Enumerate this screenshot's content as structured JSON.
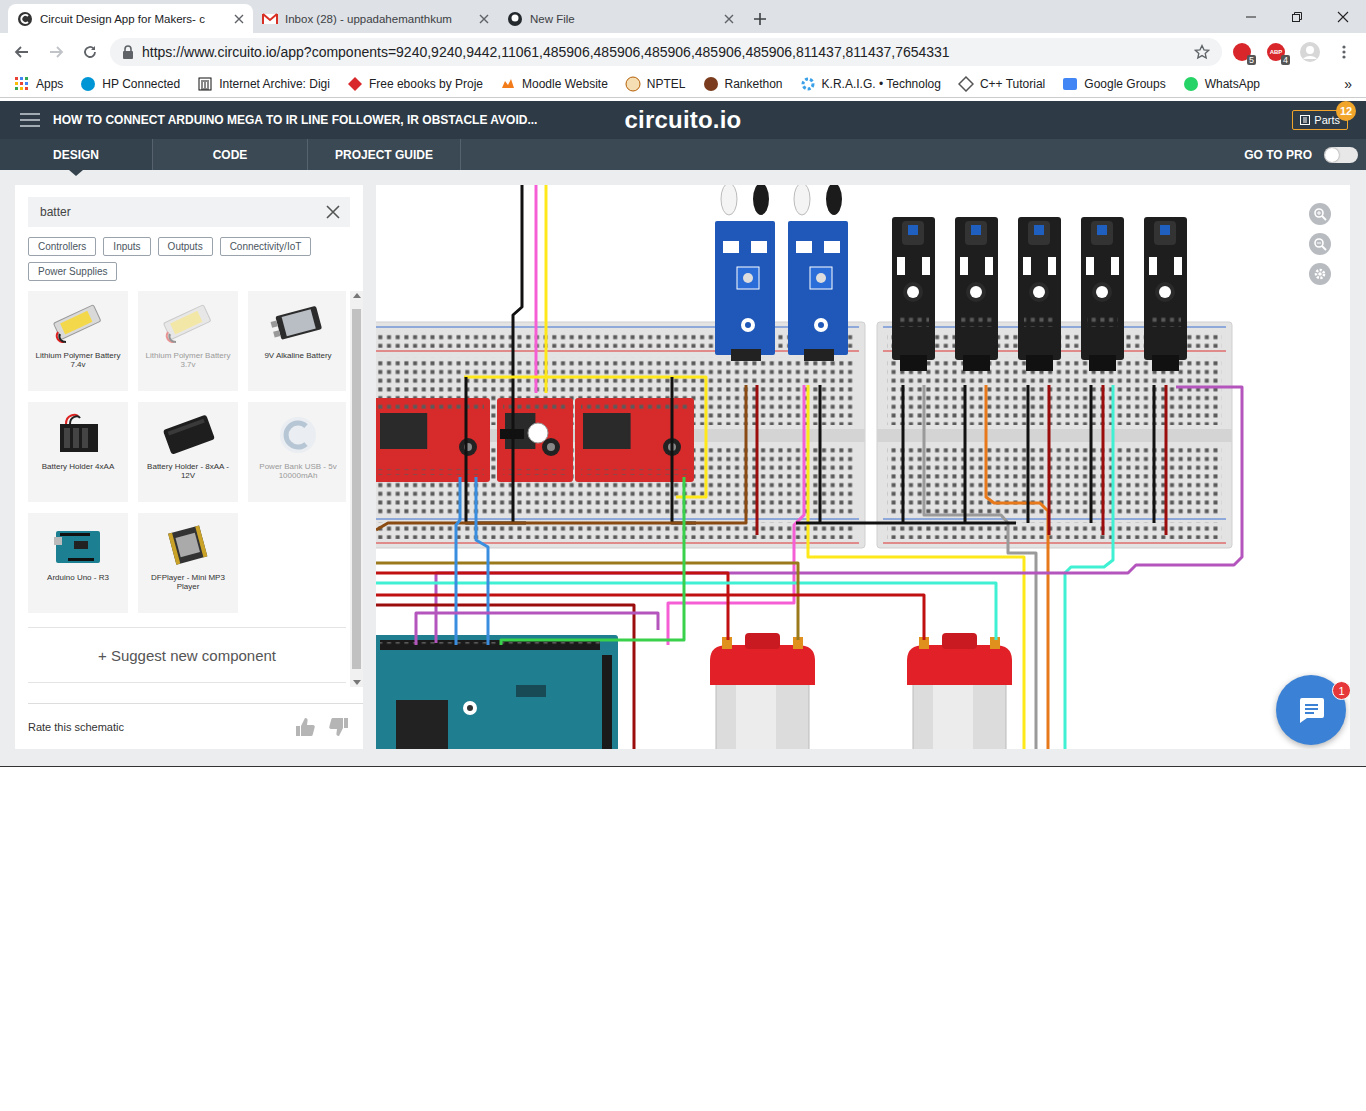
{
  "browser": {
    "tabs": [
      {
        "label": "Circuit Design App for Makers- c",
        "selected": true
      },
      {
        "label": "Inbox (28) - uppadahemanthkum",
        "selected": false
      },
      {
        "label": "New File",
        "selected": false
      }
    ],
    "url": "https://www.circuito.io/app?components=9240,9240,9442,11061,485906,485906,485906,485906,485906,811437,811437,7654331",
    "extensions": [
      {
        "label": "",
        "badge": "5"
      },
      {
        "label": "ABP",
        "badge": "4"
      }
    ],
    "bookmarks": [
      "Apps",
      "HP Connected",
      "Internet Archive: Digi",
      "Free ebooks by Proje",
      "Moodle Website",
      "NPTEL",
      "Rankethon",
      "K.R.A.I.G. • Technolog",
      "C++ Tutorial",
      "Google Groups",
      "WhatsApp"
    ],
    "more": "»"
  },
  "app": {
    "title": "HOW TO CONNECT ARDUINO MEGA TO IR LINE FOLLOWER, IR OBSTACLE AVOID...",
    "logo": "circuito.io",
    "parts": {
      "label": "Parts",
      "count": "12"
    }
  },
  "nav": {
    "tabs": [
      {
        "label": "DESIGN",
        "selected": true
      },
      {
        "label": "CODE",
        "selected": false
      },
      {
        "label": "PROJECT GUIDE",
        "selected": false
      }
    ],
    "pro": {
      "label": "GO TO PRO",
      "on": false
    }
  },
  "search": {
    "value": "batter"
  },
  "filters": [
    "Controllers",
    "Inputs",
    "Outputs",
    "Connectivity/IoT",
    "Power Supplies"
  ],
  "components": [
    {
      "name": "Lithium Polymer Battery 7.4v",
      "disabled": false,
      "kind": "lipo"
    },
    {
      "name": "Lithium Polymer Battery 3.7v",
      "disabled": true,
      "kind": "lipo"
    },
    {
      "name": "9V Alkaline Battery",
      "disabled": false,
      "kind": "ninevolt"
    },
    {
      "name": "Battery Holder 4xAA",
      "disabled": false,
      "kind": "holder4"
    },
    {
      "name": "Battery Holder - 8xAA - 12V",
      "disabled": false,
      "kind": "holder8"
    },
    {
      "name": "Power Bank USB - 5v 10000mAh",
      "disabled": true,
      "kind": "powerbank"
    },
    {
      "name": "Arduino Uno - R3",
      "disabled": false,
      "kind": "uno"
    },
    {
      "name": "DFPlayer - Mini MP3 Player",
      "disabled": false,
      "kind": "mp3"
    }
  ],
  "suggest": "+ Suggest new component",
  "rate": "Rate this schematic",
  "canvas": {
    "wires": [
      {
        "color": "#111111"
      },
      {
        "color": "#f65ed6"
      },
      {
        "color": "#ffe81a"
      },
      {
        "color": "#ffe81a"
      },
      {
        "color": "#111111"
      },
      {
        "color": "#111111"
      },
      {
        "color": "#8a4b12"
      },
      {
        "color": "#9b0d0d"
      },
      {
        "color": "#111111"
      },
      {
        "color": "#ffe81a"
      },
      {
        "color": "#f65ed6"
      },
      {
        "color": "#111111"
      },
      {
        "color": "#9a9a9a"
      },
      {
        "color": "#111111"
      },
      {
        "color": "#e8791a"
      },
      {
        "color": "#111111"
      },
      {
        "color": "#9b0d0d"
      },
      {
        "color": "#111111"
      },
      {
        "color": "#9b0d0d"
      },
      {
        "color": "#3ff0d2"
      },
      {
        "color": "#111111"
      },
      {
        "color": "#9b0d0d"
      },
      {
        "color": "#b455bd"
      },
      {
        "color": "#111111"
      },
      {
        "color": "#c01010"
      },
      {
        "color": "#3ff0d2"
      },
      {
        "color": "#9b7a1c"
      },
      {
        "color": "#c01010"
      },
      {
        "color": "#9b0d0d"
      },
      {
        "color": "#3a8ee0"
      },
      {
        "color": "#3a8ee0"
      },
      {
        "color": "#39d14b"
      },
      {
        "color": "#b455bd"
      }
    ],
    "chat_badge": "1"
  }
}
